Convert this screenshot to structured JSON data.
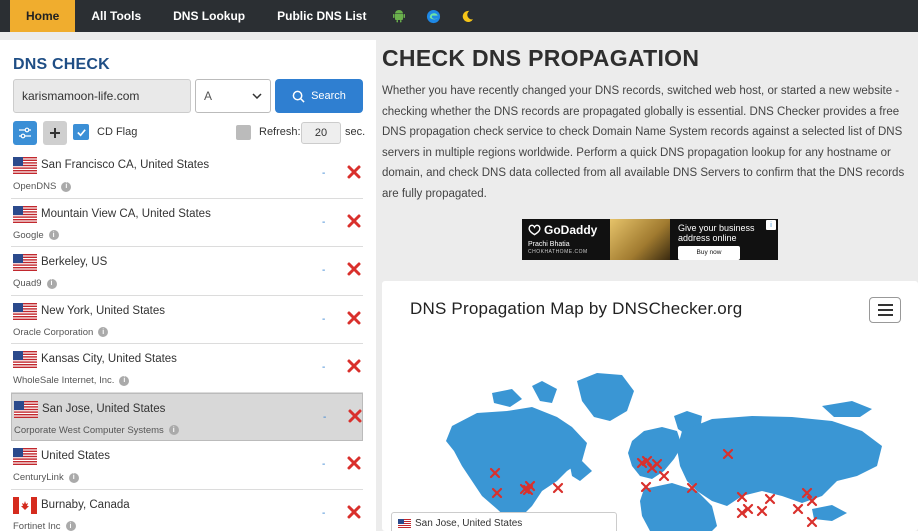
{
  "nav": {
    "items": [
      {
        "label": "Home",
        "active": true
      },
      {
        "label": "All Tools"
      },
      {
        "label": "DNS Lookup"
      },
      {
        "label": "Public DNS List"
      }
    ],
    "icons": [
      "android-icon",
      "edge-icon",
      "moon-icon"
    ]
  },
  "check": {
    "title": "DNS CHECK",
    "domain_value": "karismamoon-life.com",
    "record_type": "A",
    "search_label": "Search",
    "cd_flag_label": "CD Flag",
    "refresh_label": "Refresh:",
    "refresh_value": "20",
    "sec_label": "sec."
  },
  "servers": [
    {
      "location": "San Francisco CA, United States",
      "provider": "OpenDNS",
      "country": "us",
      "result": "-"
    },
    {
      "location": "Mountain View CA, United States",
      "provider": "Google",
      "country": "us",
      "result": "-"
    },
    {
      "location": "Berkeley, US",
      "provider": "Quad9",
      "country": "us",
      "result": "-"
    },
    {
      "location": "New York, United States",
      "provider": "Oracle Corporation",
      "country": "us",
      "result": "-"
    },
    {
      "location": "Kansas City, United States",
      "provider": "WholeSale Internet, Inc.",
      "country": "us",
      "result": "-"
    },
    {
      "location": "San Jose, United States",
      "provider": "Corporate West Computer Systems",
      "country": "us",
      "result": "-",
      "highlight": true
    },
    {
      "location": "United States",
      "provider": "CenturyLink",
      "country": "us",
      "result": "-"
    },
    {
      "location": "Burnaby, Canada",
      "provider": "Fortinet Inc",
      "country": "ca",
      "result": "-"
    }
  ],
  "content": {
    "title": "CHECK DNS PROPAGATION",
    "description": "Whether you have recently changed your DNS records, switched web host, or started a new website - checking whether the DNS records are propagated globally is essential. DNS Checker provides a free DNS propagation check service to check Domain Name System records against a selected list of DNS servers in multiple regions worldwide. Perform a quick DNS propagation lookup for any hostname or domain, and check DNS data collected from all available DNS Servers to confirm that the DNS records are fully propagated."
  },
  "ad": {
    "brand": "GoDaddy",
    "person": "Prachi Bhatia",
    "site": "CHOKHATHOME.COM",
    "headline": "Give your business address online",
    "cta": "Buy now"
  },
  "map": {
    "title": "DNS Propagation Map by DNSChecker.org",
    "tooltip": "San Jose, United States",
    "land_color": "#3a96d4"
  }
}
